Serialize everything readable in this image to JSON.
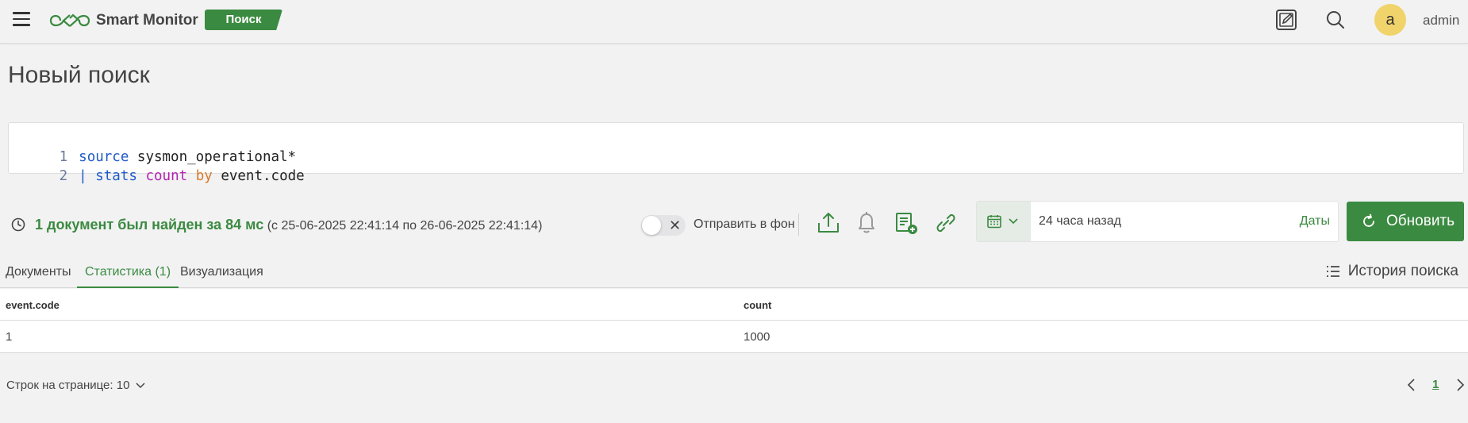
{
  "header": {
    "app_name": "Smart Monitor",
    "mode_badge": "Поиск",
    "user_initial": "a",
    "user_name": "admin"
  },
  "page": {
    "title": "Новый поиск"
  },
  "editor": {
    "lines": [
      {
        "number": "1",
        "tokens": [
          {
            "text": "source",
            "kind": "blue"
          },
          {
            "text": " sysmon_operational*",
            "kind": "text"
          }
        ]
      },
      {
        "number": "2",
        "tokens": [
          {
            "text": "| ",
            "kind": "blue"
          },
          {
            "text": "stats",
            "kind": "blue"
          },
          {
            "text": " ",
            "kind": "text"
          },
          {
            "text": "count",
            "kind": "mag"
          },
          {
            "text": " ",
            "kind": "text"
          },
          {
            "text": "by",
            "kind": "orange"
          },
          {
            "text": " event.code",
            "kind": "text"
          }
        ]
      }
    ]
  },
  "status": {
    "found_text": "1 документ был найден за 84 мс",
    "range_text": " (с 25-06-2025 22:41:14 по 26-06-2025 22:41:14)",
    "send_background_label": "Отправить в фон",
    "send_background_on": false
  },
  "time": {
    "value": "24 часа назад",
    "dates_label": "Даты"
  },
  "refresh_label": "Обновить",
  "tabs": [
    {
      "label": "Документы",
      "active": false
    },
    {
      "label": "Статистика (1)",
      "active": true
    },
    {
      "label": "Визуализация",
      "active": false
    }
  ],
  "history_label": "История поиска",
  "table": {
    "columns": [
      "event.code",
      "count"
    ],
    "rows": [
      [
        "1",
        "1000"
      ]
    ]
  },
  "pagination": {
    "rows_per_page_label": "Строк на странице: 10",
    "current_page": "1"
  },
  "colors": {
    "accent": "#3b8a41",
    "avatar": "#f0d36a"
  },
  "icons": [
    "menu-icon",
    "logo-icon",
    "notes-icon",
    "search-icon",
    "clock-icon",
    "close-icon",
    "export-icon",
    "bell-icon",
    "add-report-icon",
    "link-icon",
    "calendar-icon",
    "chevron-down-icon",
    "refresh-icon",
    "list-icon",
    "chevron-left-icon",
    "chevron-right-icon"
  ]
}
